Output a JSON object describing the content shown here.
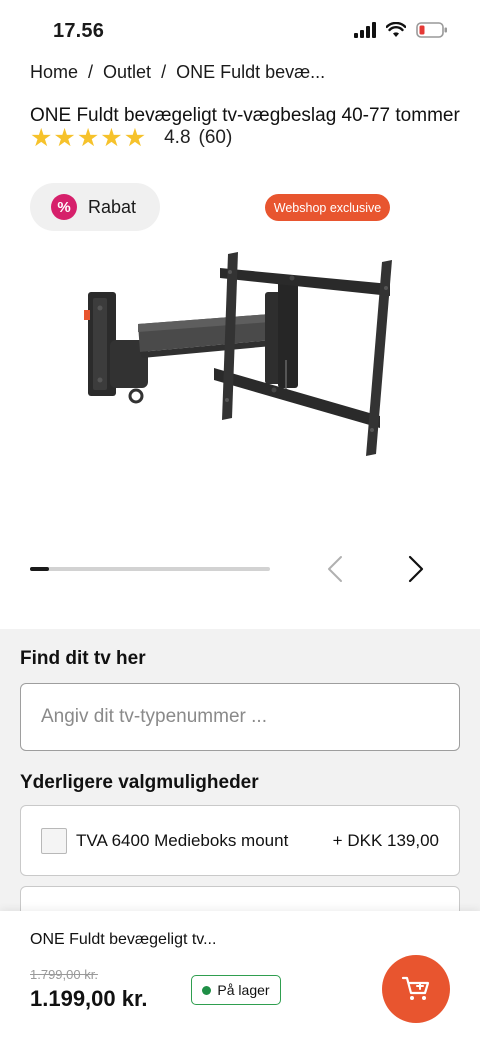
{
  "status_bar": {
    "time": "17.56"
  },
  "breadcrumb": {
    "items": [
      "Home",
      "Outlet",
      "ONE Fuldt bevæ..."
    ],
    "separator": "/"
  },
  "product": {
    "title": "ONE Fuldt bevægeligt tv-vægbeslag 40-77 tommer",
    "rating": "4.8",
    "review_count": "(60)",
    "stars": 5,
    "rabat_label": "Rabat",
    "webshop_badge": "Webshop exclusive",
    "gallery_progress": 0.08
  },
  "find_tv": {
    "heading": "Find dit tv her",
    "placeholder": "Angiv dit tv-typenummer ..."
  },
  "options": {
    "heading": "Yderligere valgmuligheder",
    "items": [
      {
        "name": "TVA 6400 Medieboks mount",
        "price": "+ DKK 139,00"
      },
      {
        "name": "",
        "price": ""
      }
    ]
  },
  "bottom_bar": {
    "title": "ONE Fuldt bevægeligt tv...",
    "old_price": "1.799,00 kr.",
    "new_price": "1.199,00 kr.",
    "stock_label": "På lager"
  },
  "colors": {
    "accent": "#e8552f",
    "rabat": "#d6206b",
    "star": "#f6c22b",
    "stock": "#1f8f46"
  },
  "icons": [
    "signal-icon",
    "wifi-icon",
    "battery-icon",
    "percent-icon",
    "chevron-left-icon",
    "chevron-right-icon",
    "cart-icon"
  ]
}
